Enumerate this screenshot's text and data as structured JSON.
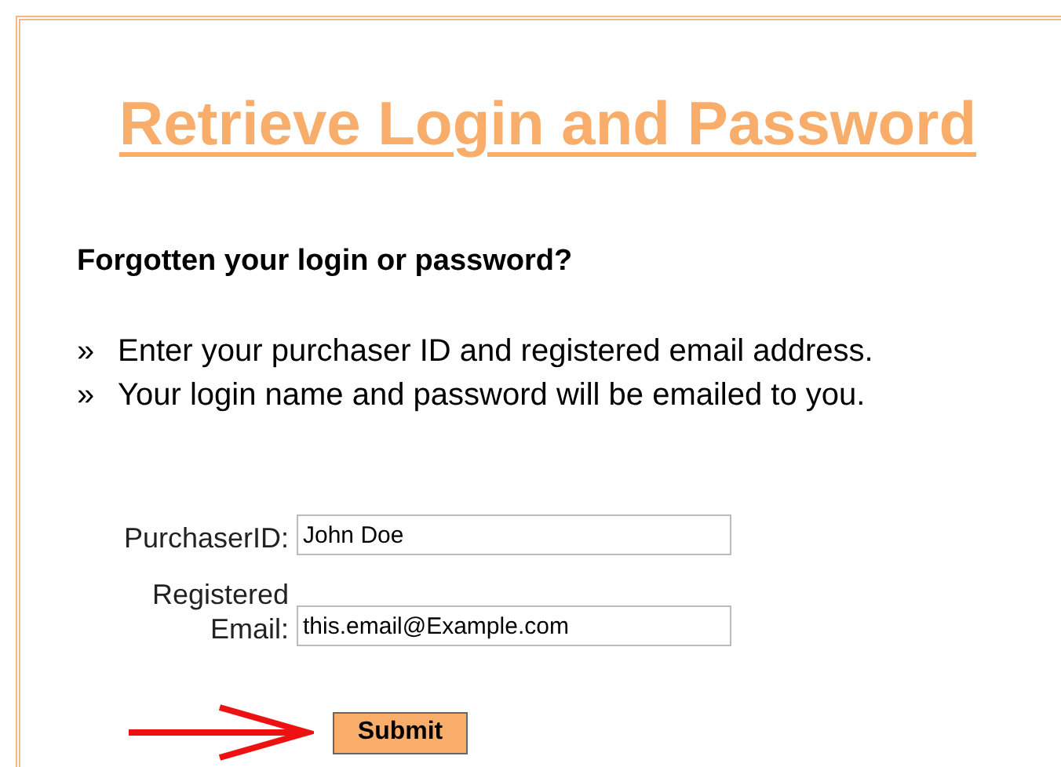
{
  "title": "Retrieve Login and Password",
  "heading": "Forgotten your login or password?",
  "instructions": [
    {
      "bullet": "»",
      "text": "Enter your purchaser ID and registered email address."
    },
    {
      "bullet": "»",
      "text": "Your login name and password will be emailed to you."
    }
  ],
  "form": {
    "fields": [
      {
        "label": "PurchaserID:",
        "value": "John Doe"
      },
      {
        "label": "Registered Email:",
        "value": "this.email@Example.com"
      }
    ],
    "submit": "Submit"
  }
}
